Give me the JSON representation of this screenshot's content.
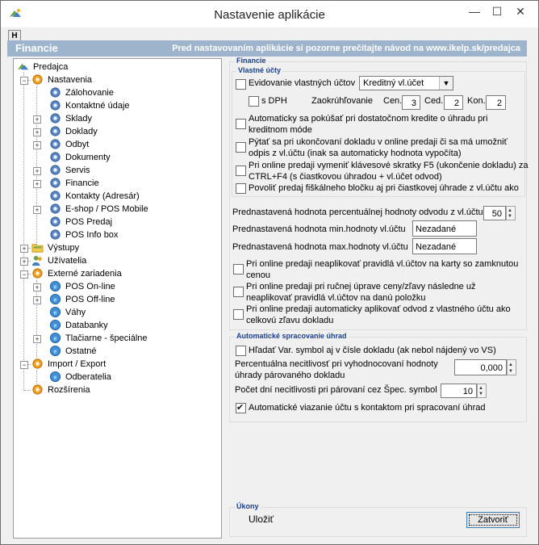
{
  "window": {
    "title": "Nastavenie aplikácie",
    "min": "—",
    "max": "☐",
    "close": "✕"
  },
  "tab": {
    "label": "H"
  },
  "banner": {
    "left": "Financie",
    "right": "Pred nastavovaním aplikácie si pozorne prečítajte návod na www.ikelp.sk/predajca"
  },
  "tree": {
    "root": "Predajca",
    "nastavenia": "Nastavenia",
    "zalohovanie": "Zálohovanie",
    "kontaktne": "Kontaktné údaje",
    "sklady": "Sklady",
    "doklady": "Doklady",
    "odbyt": "Odbyt",
    "dokumenty": "Dokumenty",
    "servis": "Servis",
    "financie": "Financie",
    "kontakty": "Kontakty (Adresár)",
    "eshop": "E-shop / POS Mobile",
    "pos_predaj": "POS Predaj",
    "pos_info": "POS Info box",
    "vystupy": "Výstupy",
    "uzivatelia": "Užívatelia",
    "externe": "Externé zariadenia",
    "pos_online": "POS On-line",
    "pos_offline": "POS Off-line",
    "vahy": "Váhy",
    "databanky": "Databanky",
    "tlaciarne": "Tlačiarne - špeciálne",
    "ostatne": "Ostatné",
    "import_export": "Import / Export",
    "odberatelia": "Odberatelia",
    "rozsirenia": "Rozšírenia"
  },
  "financie": {
    "group_title": "Financie",
    "vlastne_title": "Vlastné účty",
    "evidovanie": "Evidovanie vlastných účtov",
    "evidovanie_select": "Kreditný vl.účet",
    "s_dph": "s DPH",
    "zaokruhlovanie": "Zaokrúhľovanie",
    "cen_label": "Cen.",
    "cen_value": "3",
    "ced_label": "Ced.",
    "ced_value": "2",
    "kon_label": "Kon.",
    "kon_value": "2",
    "opt1_line1": "Automaticky sa pokúšať pri dostatočnom kredite o úhradu pri",
    "opt1_line2": "kreditnom móde",
    "opt2_line1": "Pýtať sa pri ukončovaní dokladu v online predaji či sa má umožniť",
    "opt2_line2": "odpis z vl.účtu (inak sa automaticky hodnota vypočíta)",
    "opt3_line1": "Pri online predaji vymeniť klávesové skratky F5 (ukončenie dokladu) za",
    "opt3_line2": "CTRL+F4 (s čiastkovou úhradou + vl.účet odvod)",
    "opt4": "Povoliť predaj fiškálneho bločku aj pri čiastkovej úhrade z vl.účtu ako",
    "perc_label": "Prednastavená hodnota percentuálnej hodnoty odvodu z vl.účtu",
    "perc_value": "50",
    "min_label": "Prednastavená hodnota min.hodnoty vl.účtu",
    "min_value": "Nezadané",
    "max_label": "Prednastavená hodnota max.hodnoty vl.účtu",
    "max_value": "Nezadané",
    "opt5_line1": "Pri online predaji neaplikovať pravidlá vl.účtov na karty so zamknutou",
    "opt5_line2": "cenou",
    "opt6_line1": "Pri online predaji pri ručnej úprave ceny/zľavy následne už",
    "opt6_line2": "neaplikovať pravidlá vl.účtov na danú položku",
    "opt7_line1": "Pri online predaji automaticky aplikovať odvod z vlastného účtu ako",
    "opt7_line2": "celkovú zľavu dokladu"
  },
  "auto": {
    "title": "Automatické spracovanie úhrad",
    "var_symbol": "Hľadať Var. symbol aj v čísle dokladu (ak nebol nájdený vo VS)",
    "perc_line1": "Percentuálna necitlivosť pri vyhodnocovaní hodnoty",
    "perc_line2": "úhrady párovaného dokladu",
    "perc_value": "0,000",
    "days_label": "Počet dní necitlivosti pri párovaní cez Špec. symbol",
    "days_value": "10",
    "link_contact": "Automatické viazanie účtu s kontaktom pri spracovaní úhrad"
  },
  "actions": {
    "title": "Úkony",
    "save": "Uložiť",
    "close": "Zatvoriť"
  }
}
